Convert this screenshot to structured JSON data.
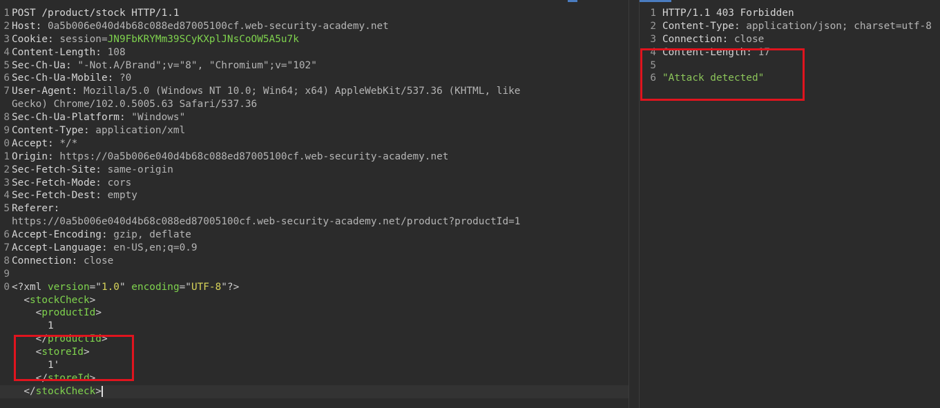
{
  "request": {
    "lines": [
      {
        "num": "1",
        "segments": [
          {
            "t": "POST /product/stock HTTP/1.1",
            "c": "key"
          }
        ]
      },
      {
        "num": "2",
        "segments": [
          {
            "t": "Host: ",
            "c": "key"
          },
          {
            "t": "0a5b006e040d4b68c088ed87005100cf.web-security-academy.net",
            "c": "val"
          }
        ]
      },
      {
        "num": "3",
        "segments": [
          {
            "t": "Cookie: ",
            "c": "key"
          },
          {
            "t": "session=",
            "c": "val"
          },
          {
            "t": "JN9FbKRYMm39SCyKXplJNsCoOW5A5u7k",
            "c": "ck-val"
          }
        ]
      },
      {
        "num": "4",
        "segments": [
          {
            "t": "Content-Length: ",
            "c": "key"
          },
          {
            "t": "108",
            "c": "val"
          }
        ]
      },
      {
        "num": "5",
        "segments": [
          {
            "t": "Sec-Ch-Ua: ",
            "c": "key"
          },
          {
            "t": "\"-Not.A/Brand\";v=\"8\", \"Chromium\";v=\"102\"",
            "c": "val"
          }
        ]
      },
      {
        "num": "6",
        "segments": [
          {
            "t": "Sec-Ch-Ua-Mobile: ",
            "c": "key"
          },
          {
            "t": "?0",
            "c": "val"
          }
        ]
      },
      {
        "num": "7",
        "segments": [
          {
            "t": "User-Agent: ",
            "c": "key"
          },
          {
            "t": "Mozilla/5.0 (Windows NT 10.0; Win64; x64) AppleWebKit/537.36 (KHTML, like",
            "c": "val"
          }
        ]
      },
      {
        "num": "",
        "segments": [
          {
            "t": "Gecko) Chrome/102.0.5005.63 Safari/537.36",
            "c": "val"
          }
        ]
      },
      {
        "num": "8",
        "segments": [
          {
            "t": "Sec-Ch-Ua-Platform: ",
            "c": "key"
          },
          {
            "t": "\"Windows\"",
            "c": "val"
          }
        ]
      },
      {
        "num": "9",
        "segments": [
          {
            "t": "Content-Type: ",
            "c": "key"
          },
          {
            "t": "application/xml",
            "c": "val"
          }
        ]
      },
      {
        "num": "0",
        "segments": [
          {
            "t": "Accept: ",
            "c": "key"
          },
          {
            "t": "*/*",
            "c": "val"
          }
        ]
      },
      {
        "num": "1",
        "segments": [
          {
            "t": "Origin: ",
            "c": "key"
          },
          {
            "t": "https://0a5b006e040d4b68c088ed87005100cf.web-security-academy.net",
            "c": "val"
          }
        ]
      },
      {
        "num": "2",
        "segments": [
          {
            "t": "Sec-Fetch-Site: ",
            "c": "key"
          },
          {
            "t": "same-origin",
            "c": "val"
          }
        ]
      },
      {
        "num": "3",
        "segments": [
          {
            "t": "Sec-Fetch-Mode: ",
            "c": "key"
          },
          {
            "t": "cors",
            "c": "val"
          }
        ]
      },
      {
        "num": "4",
        "segments": [
          {
            "t": "Sec-Fetch-Dest: ",
            "c": "key"
          },
          {
            "t": "empty",
            "c": "val"
          }
        ]
      },
      {
        "num": "5",
        "segments": [
          {
            "t": "Referer: ",
            "c": "key"
          }
        ]
      },
      {
        "num": "",
        "segments": [
          {
            "t": "https://0a5b006e040d4b68c088ed87005100cf.web-security-academy.net/product?productId=1",
            "c": "val"
          }
        ]
      },
      {
        "num": "6",
        "segments": [
          {
            "t": "Accept-Encoding: ",
            "c": "key"
          },
          {
            "t": "gzip, deflate",
            "c": "val"
          }
        ]
      },
      {
        "num": "7",
        "segments": [
          {
            "t": "Accept-Language: ",
            "c": "key"
          },
          {
            "t": "en-US,en;q=0.9",
            "c": "val"
          }
        ]
      },
      {
        "num": "8",
        "segments": [
          {
            "t": "Connection: ",
            "c": "key"
          },
          {
            "t": "close",
            "c": "val"
          }
        ]
      },
      {
        "num": "9",
        "segments": []
      },
      {
        "num": "0",
        "segments": [
          {
            "t": "<?xml ",
            "c": "punc"
          },
          {
            "t": "version",
            "c": "tag"
          },
          {
            "t": "=\"",
            "c": "punc"
          },
          {
            "t": "1.0",
            "c": "str"
          },
          {
            "t": "\" ",
            "c": "punc"
          },
          {
            "t": "encoding",
            "c": "tag"
          },
          {
            "t": "=\"",
            "c": "punc"
          },
          {
            "t": "UTF-8",
            "c": "str"
          },
          {
            "t": "\"?>",
            "c": "punc"
          }
        ]
      },
      {
        "num": "",
        "segments": [
          {
            "t": "  <",
            "c": "punc"
          },
          {
            "t": "stockCheck",
            "c": "tag"
          },
          {
            "t": ">",
            "c": "punc"
          }
        ]
      },
      {
        "num": "",
        "segments": [
          {
            "t": "    <",
            "c": "punc"
          },
          {
            "t": "productId",
            "c": "tag"
          },
          {
            "t": ">",
            "c": "punc"
          }
        ]
      },
      {
        "num": "",
        "segments": [
          {
            "t": "      1",
            "c": "key"
          }
        ]
      },
      {
        "num": "",
        "segments": [
          {
            "t": "    </",
            "c": "punc"
          },
          {
            "t": "productId",
            "c": "tag"
          },
          {
            "t": ">",
            "c": "punc"
          }
        ]
      },
      {
        "num": "",
        "segments": [
          {
            "t": "    <",
            "c": "punc"
          },
          {
            "t": "storeId",
            "c": "tag"
          },
          {
            "t": ">",
            "c": "punc"
          }
        ]
      },
      {
        "num": "",
        "segments": [
          {
            "t": "      1'",
            "c": "key"
          }
        ]
      },
      {
        "num": "",
        "segments": [
          {
            "t": "    </",
            "c": "punc"
          },
          {
            "t": "storeId",
            "c": "tag"
          },
          {
            "t": ">",
            "c": "punc"
          }
        ]
      },
      {
        "num": "",
        "segments": [
          {
            "t": "  </",
            "c": "punc"
          },
          {
            "t": "stockCheck",
            "c": "tag"
          },
          {
            "t": ">",
            "c": "punc"
          }
        ],
        "current": true
      }
    ]
  },
  "response": {
    "lines": [
      {
        "num": "1",
        "segments": [
          {
            "t": "HTTP/1.1 403 Forbidden",
            "c": "key"
          }
        ]
      },
      {
        "num": "2",
        "segments": [
          {
            "t": "Content-Type: ",
            "c": "key"
          },
          {
            "t": "application/json; charset=utf-8",
            "c": "val"
          }
        ]
      },
      {
        "num": "3",
        "segments": [
          {
            "t": "Connection: ",
            "c": "key"
          },
          {
            "t": "close",
            "c": "val"
          }
        ]
      },
      {
        "num": "4",
        "segments": [
          {
            "t": "Content-Length: ",
            "c": "key"
          },
          {
            "t": "17",
            "c": "val"
          }
        ]
      },
      {
        "num": "5",
        "segments": []
      },
      {
        "num": "6",
        "segments": [
          {
            "t": "\"Attack detected\"",
            "c": "json-str"
          }
        ]
      }
    ]
  }
}
